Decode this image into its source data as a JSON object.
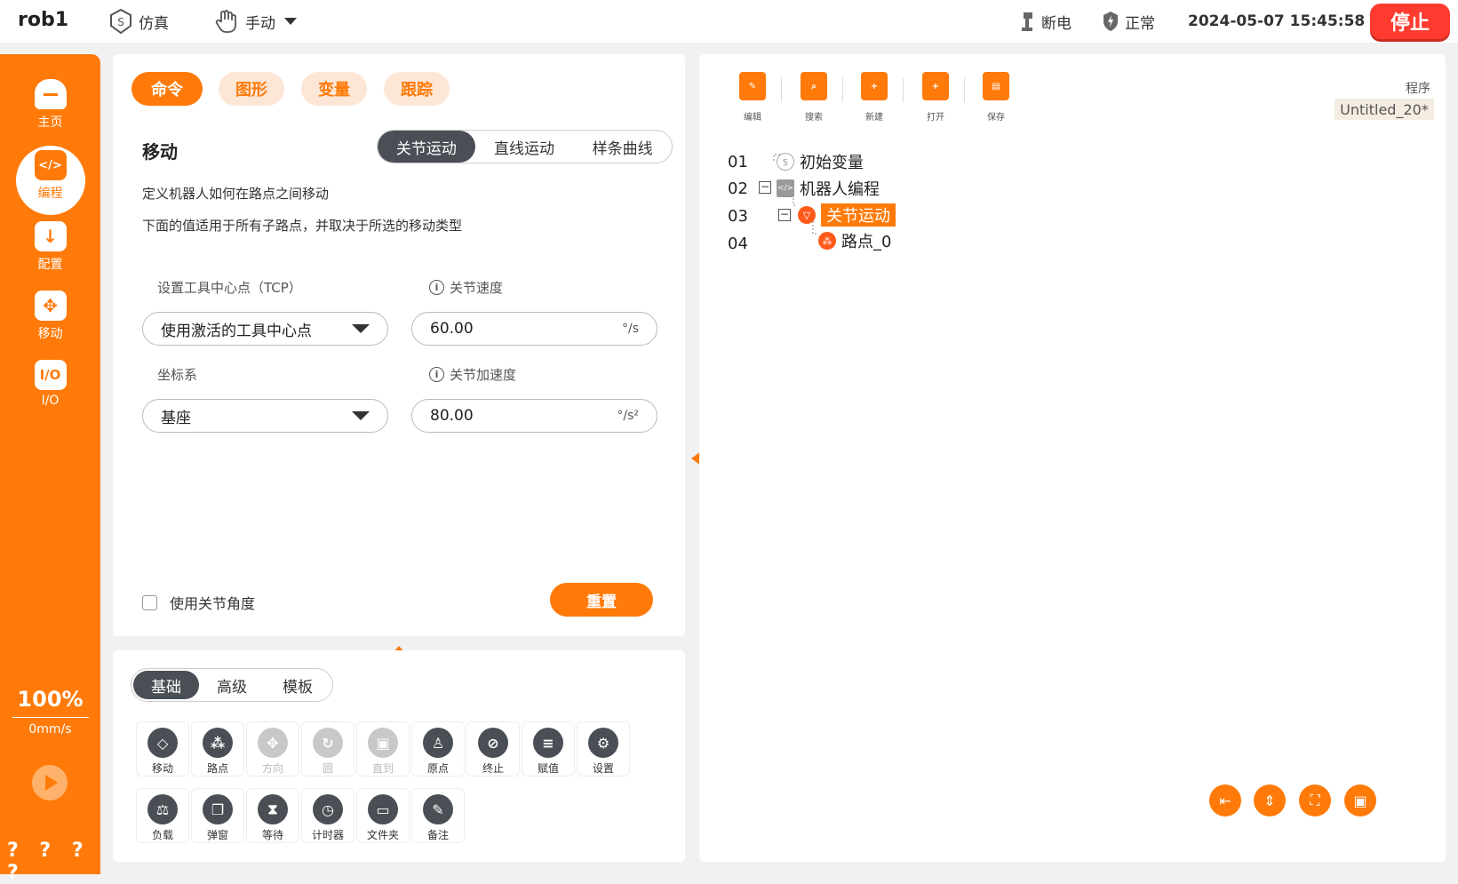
{
  "topbar": {
    "robot": "rob1",
    "sim_label": "仿真",
    "mode_label": "手动",
    "power_label": "断电",
    "safety_label": "正常",
    "datetime": "2024-05-07 15:45:58",
    "stop_label": "停止"
  },
  "sidebar": {
    "items": [
      {
        "label": "主页",
        "icon": "home-icon"
      },
      {
        "label": "编程",
        "icon": "code-icon"
      },
      {
        "label": "配置",
        "icon": "download-icon"
      },
      {
        "label": "移动",
        "icon": "move-icon"
      },
      {
        "label": "I/O",
        "icon": "io-icon"
      }
    ],
    "speed_pct": "100%",
    "speed_val": "0mm/s",
    "help": "? ? ? ?"
  },
  "tabs": [
    "命令",
    "图形",
    "变量",
    "跟踪"
  ],
  "move": {
    "title": "移动",
    "types": [
      "关节运动",
      "直线运动",
      "样条曲线"
    ],
    "desc1": "定义机器人如何在路点之间移动",
    "desc2": "下面的值适用于所有子路点，并取决于所选的移动类型",
    "tcp_label": "设置工具中心点（TCP）",
    "tcp_value": "使用激活的工具中心点",
    "joint_speed_label": "关节速度",
    "joint_speed_value": "60.00",
    "joint_speed_unit": "°/s",
    "frame_label": "坐标系",
    "frame_value": "基座",
    "joint_acc_label": "关节加速度",
    "joint_acc_value": "80.00",
    "joint_acc_unit": "°/s²",
    "use_joint_angle": "使用关节角度",
    "reset": "重置"
  },
  "cmd_tabs": [
    "基础",
    "高级",
    "模板"
  ],
  "commands_row1": [
    "移动",
    "路点",
    "方向",
    "圆",
    "直到",
    "原点",
    "终止",
    "赋值",
    "设置"
  ],
  "commands_row2": [
    "负载",
    "弹窗",
    "等待",
    "计时器",
    "文件夹",
    "备注"
  ],
  "toolbar": [
    "编辑",
    "搜索",
    "新建",
    "打开",
    "保存"
  ],
  "program": {
    "label": "程序",
    "name": "Untitled_20*"
  },
  "tree": {
    "nums": [
      "01",
      "02",
      "03",
      "04"
    ],
    "nodes": [
      "初始变量",
      "机器人编程",
      "关节运动",
      "路点_0"
    ]
  },
  "colors": {
    "accent": "#ff7a08",
    "stop": "#ff3b2f",
    "dark": "#4a4e55"
  }
}
